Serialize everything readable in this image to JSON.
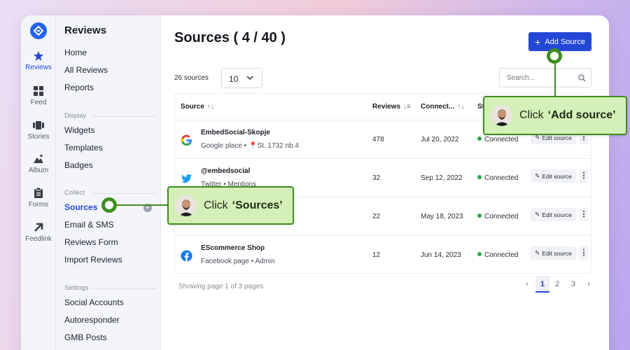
{
  "rail": {
    "items": [
      {
        "label": "Reviews",
        "icon": "star-icon",
        "active": true
      },
      {
        "label": "Feed",
        "icon": "grid-icon"
      },
      {
        "label": "Stories",
        "icon": "stories-icon"
      },
      {
        "label": "Album",
        "icon": "image-icon"
      },
      {
        "label": "Forms",
        "icon": "clipboard-icon"
      },
      {
        "label": "Feedlink",
        "icon": "arrow-up-right-icon"
      }
    ]
  },
  "menu": {
    "title": "Reviews",
    "top": [
      "Home",
      "All Reviews",
      "Reports"
    ],
    "display_label": "Display",
    "display": [
      "Widgets",
      "Templates",
      "Badges"
    ],
    "collect_label": "Collect",
    "collect": [
      "Sources",
      "Email & SMS",
      "Reviews Form",
      "Import Reviews"
    ],
    "settings_label": "Settings",
    "settings": [
      "Social Accounts",
      "Autoresponder",
      "GMB Posts"
    ]
  },
  "main": {
    "title": "Sources ( 4 / 40 )",
    "add_label": "Add Source",
    "count": "26 sources",
    "per_page": "10",
    "search_placeholder": "Search...",
    "columns": [
      "Source",
      "Reviews",
      "Connect...",
      "St"
    ],
    "rows": [
      {
        "name": "EmbedSocial-Skopje",
        "sub": "Google place • 📍St. 1732 nb.4",
        "icon": "google-icon",
        "reviews": "478",
        "connected": "Jul 20, 2022",
        "status": "Connected",
        "edit": "Edit source"
      },
      {
        "name": "@embedsocial",
        "sub": "Twitter • Mentions",
        "icon": "twitter-icon",
        "reviews": "32",
        "connected": "Sep 12, 2022",
        "status": "Connected",
        "edit": "Edit source"
      },
      {
        "name": "",
        "sub": "",
        "icon": "",
        "reviews": "22",
        "connected": "May 18, 2023",
        "status": "Connected",
        "edit": "Edit source"
      },
      {
        "name": "EScommerce Shop",
        "sub": "Facebook page • Admin",
        "icon": "facebook-icon",
        "reviews": "12",
        "connected": "Jun 14, 2023",
        "status": "Connected",
        "edit": "Edit source"
      }
    ],
    "showing": "Showing page 1 of 3 pages",
    "pages": [
      "1",
      "2",
      "3"
    ]
  },
  "callouts": {
    "add_source": {
      "prefix": "Click",
      "target": "‘Add source’"
    },
    "sources": {
      "prefix": "Click",
      "target": "‘Sources’"
    }
  },
  "colors": {
    "accent": "#2447d6",
    "callout_bg": "#d5efb9",
    "callout_border": "#3f8f1f",
    "connected": "#2aa845"
  }
}
